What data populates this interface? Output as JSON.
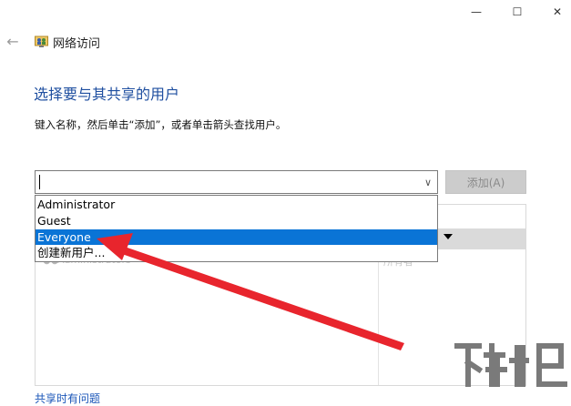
{
  "window": {
    "minimize_glyph": "—",
    "maximize_glyph": "☐",
    "close_glyph": "✕"
  },
  "nav": {
    "back_glyph": "←"
  },
  "app": {
    "title": "网络访问",
    "icon": "network-users-icon"
  },
  "page": {
    "heading": "选择要与其共享的用户",
    "instruction": "键入名称，然后单击“添加”，或者单击箭头查找用户。"
  },
  "combo": {
    "value": "",
    "arrow_glyph": "∨"
  },
  "add_button": {
    "label": "添加(A)"
  },
  "dropdown": {
    "options": [
      {
        "label": "Administrator",
        "selected": false
      },
      {
        "label": "Guest",
        "selected": false
      },
      {
        "label": "Everyone",
        "selected": true
      },
      {
        "label": "创建新用户...",
        "selected": false
      }
    ]
  },
  "shared_list": {
    "row_user": "Administrators",
    "row_level": "所有者"
  },
  "footer": {
    "help_link": "共享时有问题"
  },
  "colors": {
    "accent": "#1f4fa0",
    "selection": "#0a74d6",
    "arrow": "#e8252d",
    "link": "#1a56b8"
  }
}
